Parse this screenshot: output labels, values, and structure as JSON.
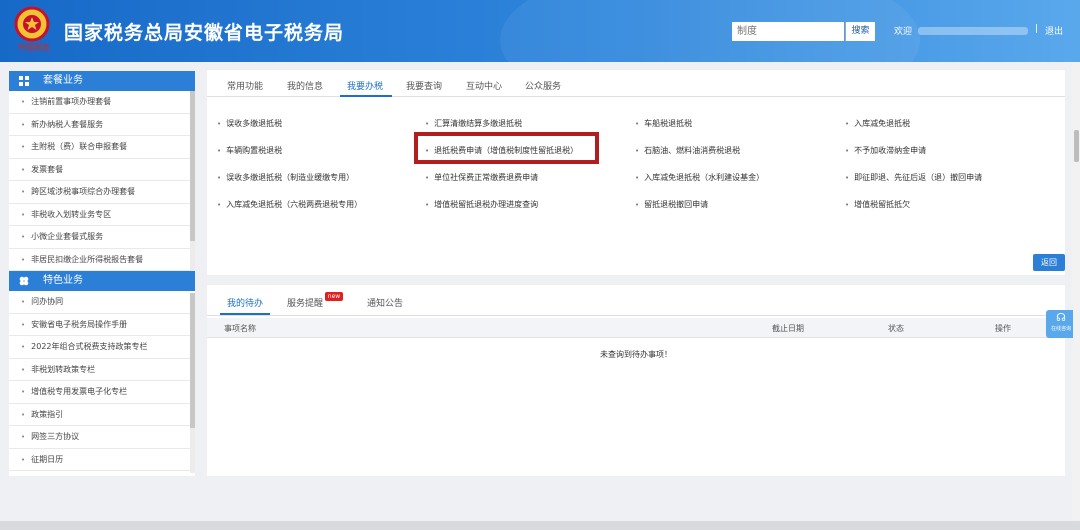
{
  "header": {
    "title": "国家税务总局安徽省电子税务局",
    "emblem_text": "中国税务",
    "search_placeholder": "制度",
    "search_button": "搜索",
    "welcome": "欢迎",
    "separator": "|",
    "logout": "退出"
  },
  "sidebar": {
    "section1": {
      "title": "套餐业务",
      "items": [
        "注销前置事项办理套餐",
        "新办纳税人套餐服务",
        "主附税（费）联合申报套餐",
        "发票套餐",
        "跨区域涉税事项综合办理套餐",
        "非税收入划转业务专区",
        "小微企业套餐式服务",
        "非居民扣缴企业所得税报告套餐"
      ]
    },
    "section2": {
      "title": "特色业务",
      "items": [
        "问办协同",
        "安徽省电子税务局操作手册",
        "2022年组合式税费支持政策专栏",
        "非税划转政策专栏",
        "增值税专用发票电子化专栏",
        "政策指引",
        "网签三方协议",
        "征期日历"
      ]
    }
  },
  "main_tabs": [
    "常用功能",
    "我的信息",
    "我要办税",
    "我要查询",
    "互动中心",
    "公众服务"
  ],
  "active_tab": "我要办税",
  "links": [
    [
      "误收多缴退抵税",
      "汇算清缴结算多缴退抵税",
      "车船税退抵税",
      "入库减免退抵税"
    ],
    [
      "车辆购置税退税",
      "退抵税费申请（增值税制度性留抵退税）",
      "石脑油、燃料油消费税退税",
      "不予加收滞纳金申请"
    ],
    [
      "误收多缴退抵税（制造业缓缴专用）",
      "单位社保费正常缴费退费申请",
      "入库减免退抵税（水利建设基金）",
      "即征即退、先征后返（退）撤回申请"
    ],
    [
      "入库减免退抵税（六税两费退税专用）",
      "增值税留抵退税办理进度查询",
      "留抵退税撤回申请",
      "增值税留抵抵欠"
    ]
  ],
  "return_button": "返回",
  "bottom_tabs": [
    "我的待办",
    "服务提醒",
    "通知公告"
  ],
  "new_badge": "new",
  "table_headers": [
    "事项名称",
    "截止日期",
    "状态",
    "操作"
  ],
  "empty_text": "未查询到待办事项！",
  "help": {
    "icon": "headset-icon",
    "label": "在线咨询"
  },
  "colors": {
    "accent": "#1a6fcf",
    "header": "#1769c7",
    "highlight": "#b01e1e"
  }
}
